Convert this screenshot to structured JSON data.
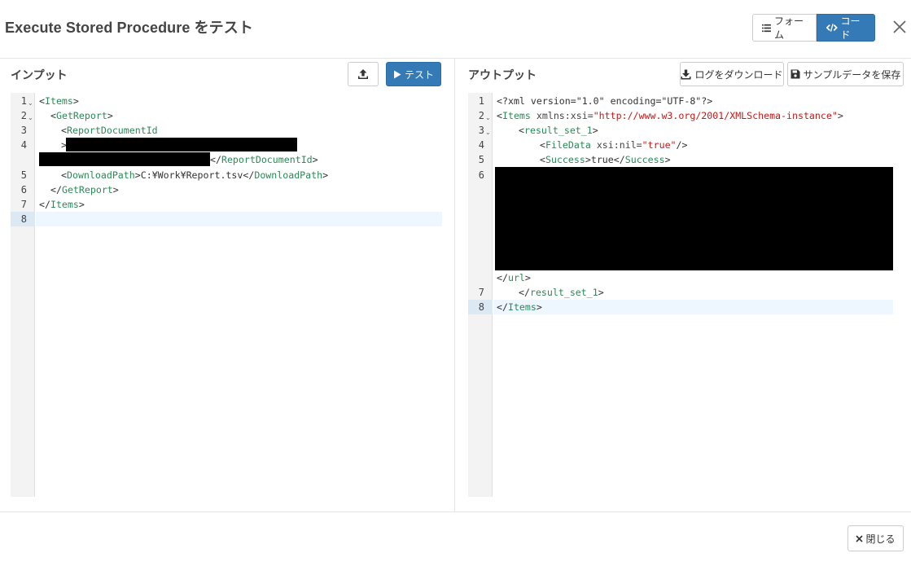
{
  "dialog": {
    "title": "Execute Stored Procedure をテスト",
    "view_toggle": {
      "form_label": "フォーム",
      "code_label": "コード",
      "selected": "code"
    },
    "close_icon": "close-icon"
  },
  "input_panel": {
    "title": "インプット",
    "upload_icon": "upload-icon",
    "test_button": "テスト",
    "line_numbers": [
      "1",
      "2",
      "3",
      "4",
      "5",
      "6",
      "7",
      "8"
    ],
    "code": {
      "line1_tag": "Items",
      "line2_tag": "GetReport",
      "line3_tag": "ReportDocumentId",
      "line4_close_tag": "ReportDocumentId",
      "line5_tag": "DownloadPath",
      "line5_value": "C:¥Work¥Report.tsv",
      "line6_tag": "GetReport",
      "line7_tag": "Items"
    }
  },
  "output_panel": {
    "title": "アウトプット",
    "download_log_button": "ログをダウンロード",
    "save_sample_button": "サンプルデータを保存",
    "line_numbers": [
      "1",
      "2",
      "3",
      "4",
      "5",
      "6",
      "7",
      "8"
    ],
    "code": {
      "line1_decl": "<?xml version=\"1.0\" encoding=\"UTF-8\"?>",
      "line2_tag": "Items",
      "line2_attr": "xmlns:xsi=",
      "line2_value": "\"http://www.w3.org/2001/XMLSchema-instance\"",
      "line3_tag": "result_set_1",
      "line4_tag": "FileData",
      "line4_attr": "xsi:nil=",
      "line4_value": "\"true\"",
      "line5_tag": "Success",
      "line5_value": "true",
      "line6_close_tag": "url",
      "line7_tag": "result_set_1",
      "line8_tag": "Items"
    }
  },
  "footer": {
    "close_button": "閉じる"
  },
  "colors": {
    "primary": "#337ab7",
    "xml_tag": "#2a8b57",
    "xml_string": "#c41a16",
    "redaction": "#000000"
  }
}
